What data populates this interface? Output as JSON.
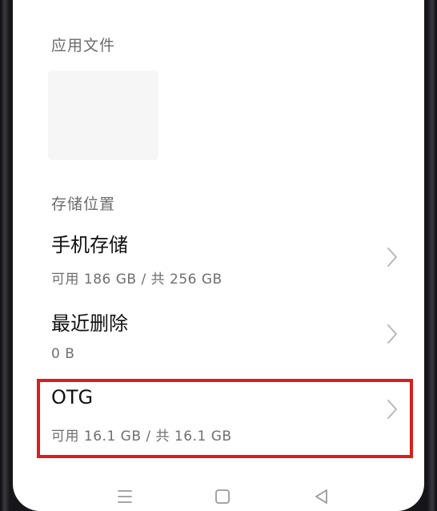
{
  "sections": {
    "app_files": {
      "label": "应用文件"
    },
    "storage_location": {
      "label": "存储位置"
    }
  },
  "storage_items": [
    {
      "title": "手机存储",
      "subtitle": "可用 186 GB / 共 256 GB",
      "icon": "chevron-right-icon"
    },
    {
      "title": "最近删除",
      "subtitle": "0 B",
      "icon": "chevron-right-icon"
    },
    {
      "title": "OTG",
      "subtitle": "可用 16.1 GB / 共 16.1 GB",
      "icon": "chevron-right-icon",
      "highlighted": true
    }
  ],
  "navbar": {
    "buttons": [
      "menu-icon",
      "home-icon",
      "back-icon"
    ]
  },
  "colors": {
    "highlight": "#d81e1e",
    "title_text": "#111111",
    "secondary_text": "#6f6f6f",
    "chevron": "#b8b8b8"
  }
}
